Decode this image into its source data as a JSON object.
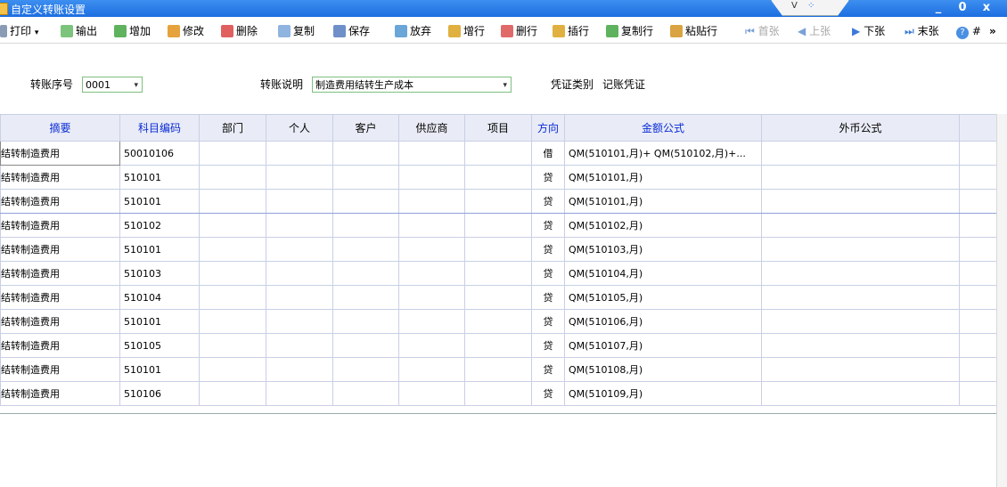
{
  "window": {
    "title": "自定义转账设置",
    "center_glyph_left": "V",
    "center_glyph_right": "⁘",
    "min_label": "_",
    "restore_label": "0",
    "close_label": "x"
  },
  "toolbar": {
    "print": "打印",
    "print_caret": "▾",
    "export": "输出",
    "add": "增加",
    "edit": "修改",
    "delete": "删除",
    "copy": "复制",
    "save": "保存",
    "discard": "放弃",
    "add_row": "增行",
    "delete_row": "删行",
    "insert_row": "插行",
    "copy_row": "复制行",
    "paste_row": "粘贴行",
    "first": "首张",
    "prev": "上张",
    "next": "下张",
    "last": "末张",
    "help_tail": "#",
    "more": "»"
  },
  "form": {
    "seq_label": "转账序号",
    "seq_value": "0001",
    "desc_label": "转账说明",
    "desc_value": "制造费用结转生产成本",
    "voucher_label": "凭证类别",
    "voucher_value": "记账凭证",
    "caret": "▾"
  },
  "table": {
    "headers": [
      "摘要",
      "科目编码",
      "部门",
      "个人",
      "客户",
      "供应商",
      "项目",
      "方向",
      "金额公式",
      "外币公式"
    ],
    "rows": [
      {
        "summary": "结转制造费用",
        "code": "50010106",
        "dir": "借",
        "formula": "QM(510101,月)+ QM(510102,月)+..."
      },
      {
        "summary": "结转制造费用",
        "code": "510101",
        "dir": "贷",
        "formula": "QM(510101,月)"
      },
      {
        "summary": "结转制造费用",
        "code": "510101",
        "dir": "贷",
        "formula": "QM(510101,月)"
      },
      {
        "summary": "结转制造费用",
        "code": "510102",
        "dir": "贷",
        "formula": "QM(510102,月)"
      },
      {
        "summary": "结转制造费用",
        "code": "510101",
        "dir": "贷",
        "formula": "QM(510103,月)"
      },
      {
        "summary": "结转制造费用",
        "code": "510103",
        "dir": "贷",
        "formula": "QM(510104,月)"
      },
      {
        "summary": "结转制造费用",
        "code": "510104",
        "dir": "贷",
        "formula": "QM(510105,月)"
      },
      {
        "summary": "结转制造费用",
        "code": "510101",
        "dir": "贷",
        "formula": "QM(510106,月)"
      },
      {
        "summary": "结转制造费用",
        "code": "510105",
        "dir": "贷",
        "formula": "QM(510107,月)"
      },
      {
        "summary": "结转制造费用",
        "code": "510101",
        "dir": "贷",
        "formula": "QM(510108,月)"
      },
      {
        "summary": "结转制造费用",
        "code": "510106",
        "dir": "贷",
        "formula": "QM(510109,月)"
      }
    ]
  },
  "colors": {
    "titlebar": "#2a7ce8",
    "header_text": "#0a2bd6",
    "header_bg": "#e9ecf6"
  }
}
